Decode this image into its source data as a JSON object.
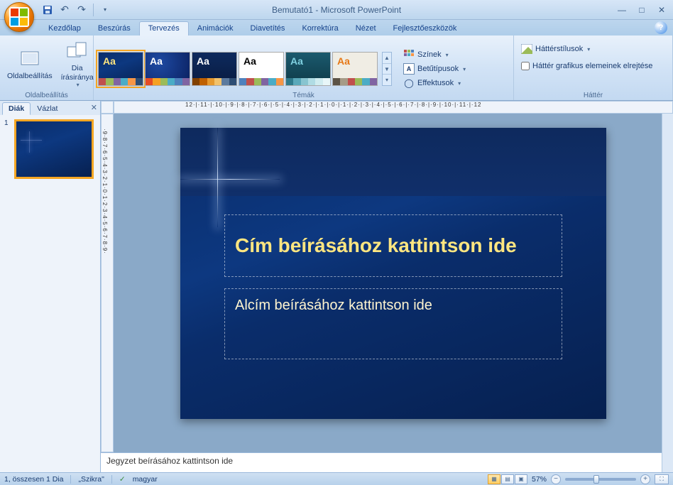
{
  "title": "Bemutató1 - Microsoft PowerPoint",
  "tabs": {
    "home": "Kezdőlap",
    "insert": "Beszúrás",
    "design": "Tervezés",
    "animations": "Animációk",
    "slideshow": "Diavetítés",
    "review": "Korrektúra",
    "view": "Nézet",
    "developer": "Fejlesztőeszközök"
  },
  "ribbon": {
    "page_setup_group": "Oldalbeállítás",
    "page_setup_btn": "Oldalbeállítás",
    "slide_orientation_btn": "Dia\nírásiránya",
    "themes_group": "Témák",
    "colors_btn": "Színek",
    "fonts_btn": "Betűtípusok",
    "effects_btn": "Effektusok",
    "background_group": "Háttér",
    "background_styles_btn": "Háttérstílusok",
    "hide_bg_graphics": "Háttér grafikus elemeinek elrejtése"
  },
  "panes": {
    "slides_tab": "Diák",
    "outline_tab": "Vázlat",
    "thumb_number": "1"
  },
  "slide": {
    "title_placeholder": "Cím beírásához kattintson ide",
    "subtitle_placeholder": "Alcím beírásához kattintson ide"
  },
  "notes": {
    "placeholder": "Jegyzet beírásához kattintson ide"
  },
  "ruler_h": "12·|·11·|·10·|·9·|·8·|·7·|·6·|·5·|·4·|·3·|·2·|·1·|·0·|·1·|·2·|·3·|·4·|·5·|·6·|·7·|·8·|·9·|·10·|·11·|·12",
  "ruler_v": "·9·8·7·6·5·4·3·2·1·0·1·2·3·4·5·6·7·8·9·",
  "status": {
    "slide_info": "1, összesen 1 Dia",
    "theme_name": "„Szikra\"",
    "language": "magyar",
    "zoom_pct": "57%"
  },
  "themes": [
    {
      "bg": "linear-gradient(160deg,#0a2d6b,#0d3880 40%,#062050)",
      "aa": "#ffe680",
      "bars": [
        "#c0504d",
        "#9bbb59",
        "#8064a2",
        "#4bacc6",
        "#f79646",
        "#2c4d75"
      ],
      "selected": true
    },
    {
      "bg": "radial-gradient(circle at 30% 30%,#1e4aa3,#0a1f5e)",
      "aa": "#fff",
      "bars": [
        "#e64c24",
        "#f6a124",
        "#9bbb59",
        "#4bacc6",
        "#4f81bd",
        "#8064a2"
      ]
    },
    {
      "bg": "linear-gradient(#0e2a5e,#081b40)",
      "aa": "#fff",
      "bars": [
        "#804000",
        "#bf6000",
        "#e6992e",
        "#f2c26b",
        "#5c7a9e",
        "#2e4d73"
      ]
    },
    {
      "bg": "#ffffff",
      "aa": "#000",
      "bars": [
        "#4f81bd",
        "#c0504d",
        "#9bbb59",
        "#8064a2",
        "#4bacc6",
        "#f79646"
      ]
    },
    {
      "bg": "linear-gradient(#1b5a6e,#0e3a48)",
      "aa": "#7fd0e0",
      "bars": [
        "#2e7a8c",
        "#5aa8ba",
        "#88c4d0",
        "#b0dce4",
        "#d0ecf0",
        "#e8f6f8"
      ]
    },
    {
      "bg": "#f0ede4",
      "aa": "#e67817",
      "bars": [
        "#5c5346",
        "#a69b87",
        "#c0504d",
        "#9bbb59",
        "#4bacc6",
        "#8064a2"
      ]
    }
  ]
}
